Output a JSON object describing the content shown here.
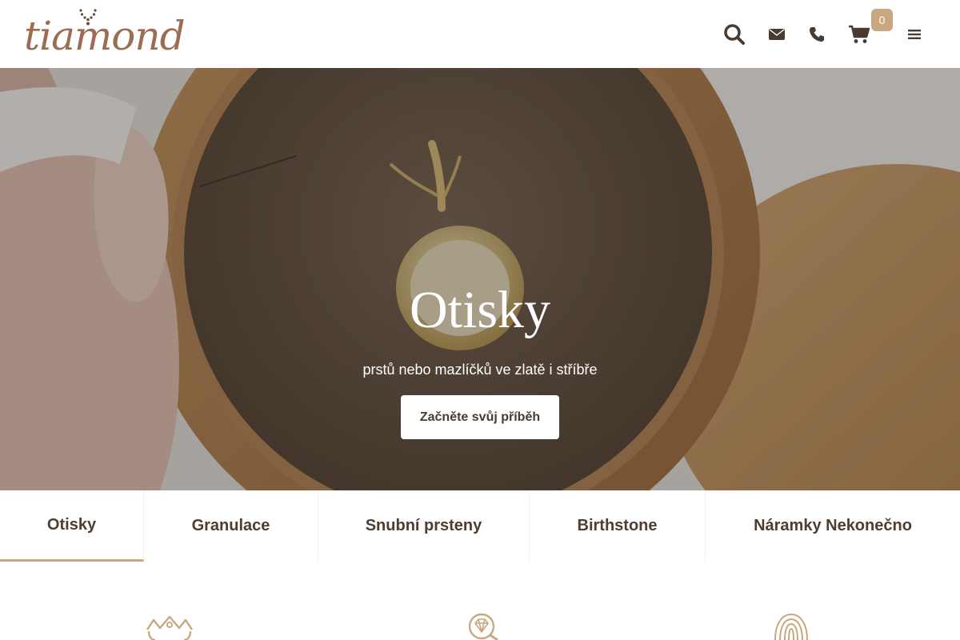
{
  "brand": {
    "logo_text": "tiamond",
    "accent": "#c9a77f",
    "logo_color": "#9b6d52"
  },
  "header": {
    "icons": [
      "search-icon",
      "mail-icon",
      "phone-icon",
      "cart-icon",
      "menu-icon"
    ],
    "cart_count": "0"
  },
  "hero": {
    "title": "Otisky",
    "subtitle": "prstů nebo mazlíčků ve zlatě i stříbře",
    "cta_label": "Začněte svůj příběh"
  },
  "tabs": [
    {
      "label": "Otisky",
      "active": true
    },
    {
      "label": "Granulace",
      "active": false
    },
    {
      "label": "Snubní prsteny",
      "active": false
    },
    {
      "label": "Birthstone",
      "active": false
    },
    {
      "label": "Náramky Nekonečno",
      "active": false
    }
  ],
  "features": {
    "icons": [
      "crown-icon",
      "diamond-search-icon",
      "fingerprint-icon"
    ]
  }
}
